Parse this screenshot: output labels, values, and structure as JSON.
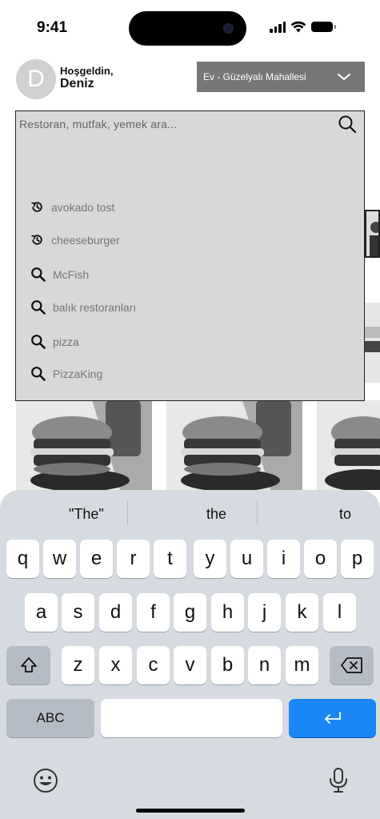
{
  "status_bar": {
    "time": "9:41",
    "icons": [
      "signal-icon",
      "wifi-icon",
      "battery-icon"
    ]
  },
  "header": {
    "avatar_initial": "D",
    "greeting": "Hoşgeldin,",
    "user_name": "Deniz",
    "address": "Ev - Güzelyalı Mahallesi"
  },
  "search": {
    "placeholder": "Restoran, mutfak, yemek ara...",
    "value": ""
  },
  "suggestions": [
    {
      "type": "history",
      "icon": "history-icon",
      "label": "avokado tost"
    },
    {
      "type": "history",
      "icon": "history-icon",
      "label": "cheeseburger"
    },
    {
      "type": "search",
      "icon": "search-icon",
      "label": "McFish"
    },
    {
      "type": "search",
      "icon": "search-icon",
      "label": "balık restoranları"
    },
    {
      "type": "search",
      "icon": "search-icon",
      "label": "pizza"
    },
    {
      "type": "search",
      "icon": "search-icon",
      "label": "PizzaKing"
    }
  ],
  "keyboard": {
    "predictions": [
      "\"The\"",
      "the",
      "to"
    ],
    "row1": [
      "q",
      "w",
      "e",
      "r",
      "t",
      "y",
      "u",
      "i",
      "o",
      "p"
    ],
    "row2": [
      "a",
      "s",
      "d",
      "f",
      "g",
      "h",
      "j",
      "k",
      "l"
    ],
    "row3": [
      "z",
      "x",
      "c",
      "v",
      "b",
      "n",
      "m"
    ],
    "abc_label": "ABC"
  },
  "colors": {
    "dropdown_bg": "#d8d8d8",
    "address_bg": "#777777",
    "return_key": "#1b87f6",
    "keyboard_bg": "#d6dbe1"
  }
}
